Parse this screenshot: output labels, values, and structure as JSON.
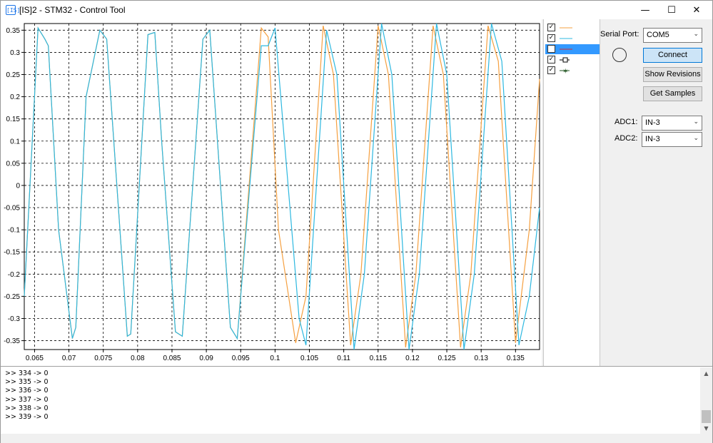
{
  "window": {
    "title": "[IS]2 - STM32 - Control Tool",
    "app_icon": "[IS]",
    "minimize_glyph": "—",
    "maximize_glyph": "☐",
    "close_glyph": "✕"
  },
  "legend": {
    "items": [
      {
        "checked": true,
        "color": "#f5a040",
        "marker": "line",
        "selected": false
      },
      {
        "checked": true,
        "color": "#2db8e0",
        "marker": "line",
        "selected": false
      },
      {
        "checked": false,
        "color": "#cc3333",
        "marker": "line",
        "selected": true
      },
      {
        "checked": true,
        "color": "#000000",
        "marker": "square",
        "selected": false
      },
      {
        "checked": true,
        "color": "#225522",
        "marker": "star",
        "selected": false
      }
    ],
    "check_glyph": "✓"
  },
  "controls": {
    "serial_port_label": "Serial Port:",
    "serial_port_value": "COM5",
    "connect_label": "Connect",
    "show_revisions_label": "Show Revisions",
    "get_samples_label": "Get Samples",
    "adc1_label": "ADC1:",
    "adc1_value": "IN-3",
    "adc2_label": "ADC2:",
    "adc2_value": "IN-3",
    "combo_arrow": "⌄"
  },
  "log": {
    "lines": [
      ">> 334 -> 0",
      ">> 335 -> 0",
      ">> 336 -> 0",
      ">> 337 -> 0",
      ">> 338 -> 0",
      ">> 339 -> 0"
    ],
    "scroll_up": "▲",
    "scroll_down": "▼"
  },
  "chart_data": {
    "type": "line",
    "xlim": [
      0.0635,
      0.1385
    ],
    "ylim": [
      -0.37,
      0.365
    ],
    "x_ticks": [
      0.065,
      0.07,
      0.075,
      0.08,
      0.085,
      0.09,
      0.095,
      0.1,
      0.105,
      0.11,
      0.115,
      0.12,
      0.125,
      0.13,
      0.135
    ],
    "x_tick_labels": [
      "0.065",
      "0.07",
      "0.075",
      "0.08",
      "0.085",
      "0.09",
      "0.095",
      "0.1",
      "0.105",
      "0.11",
      "0.115",
      "0.12",
      "0.125",
      "0.13",
      "0.135"
    ],
    "y_ticks": [
      -0.35,
      -0.3,
      -0.25,
      -0.2,
      -0.15,
      -0.1,
      -0.05,
      0,
      0.05,
      0.1,
      0.15,
      0.2,
      0.25,
      0.3,
      0.35
    ],
    "y_tick_labels": [
      "-0.35",
      "-0.3",
      "-0.25",
      "-0.2",
      "-0.15",
      "-0.1",
      "-0.05",
      "0",
      "0.05",
      "0.1",
      "0.15",
      "0.2",
      "0.25",
      "0.3",
      "0.35"
    ],
    "grid": true,
    "series": [
      {
        "color": "#f5a040",
        "x": [
          0.0635,
          0.0655,
          0.0665,
          0.067,
          0.0685,
          0.0705,
          0.071,
          0.0725,
          0.0745,
          0.0755,
          0.0785,
          0.079,
          0.0815,
          0.0825,
          0.0835,
          0.0855,
          0.0865,
          0.0895,
          0.0905,
          0.0935,
          0.0945,
          0.098,
          0.099,
          0.1005,
          0.103,
          0.1045,
          0.107,
          0.1085,
          0.111,
          0.1125,
          0.115,
          0.1165,
          0.119,
          0.1205,
          0.123,
          0.1245,
          0.127,
          0.1285,
          0.131,
          0.1325,
          0.135,
          0.137,
          0.1385
        ],
        "y": [
          -0.25,
          0.355,
          0.33,
          0.315,
          -0.1,
          -0.345,
          -0.32,
          0.2,
          0.35,
          0.33,
          -0.34,
          -0.335,
          0.34,
          0.345,
          0.1,
          -0.33,
          -0.34,
          0.33,
          0.35,
          -0.32,
          -0.345,
          0.355,
          0.335,
          -0.1,
          -0.355,
          -0.25,
          0.36,
          0.25,
          -0.36,
          -0.2,
          0.36,
          0.25,
          -0.365,
          -0.2,
          0.36,
          0.25,
          -0.365,
          -0.2,
          0.36,
          0.28,
          -0.355,
          -0.1,
          0.24
        ]
      },
      {
        "color": "#2db8e0",
        "x": [
          0.0635,
          0.0655,
          0.0665,
          0.067,
          0.0685,
          0.0705,
          0.071,
          0.0725,
          0.0745,
          0.0755,
          0.0785,
          0.079,
          0.0815,
          0.0825,
          0.0835,
          0.0855,
          0.0865,
          0.0895,
          0.0905,
          0.0935,
          0.0945,
          0.098,
          0.099,
          0.1,
          0.1035,
          0.1045,
          0.1075,
          0.109,
          0.1115,
          0.113,
          0.1155,
          0.117,
          0.1195,
          0.121,
          0.1235,
          0.125,
          0.1275,
          0.129,
          0.1315,
          0.133,
          0.1355,
          0.137,
          0.1385
        ],
        "y": [
          -0.25,
          0.355,
          0.33,
          0.315,
          -0.1,
          -0.345,
          -0.32,
          0.2,
          0.35,
          0.33,
          -0.34,
          -0.335,
          0.34,
          0.345,
          0.1,
          -0.33,
          -0.34,
          0.33,
          0.35,
          -0.32,
          -0.345,
          0.315,
          0.315,
          0.355,
          -0.3,
          -0.36,
          0.35,
          0.25,
          -0.37,
          -0.2,
          0.365,
          0.25,
          -0.37,
          -0.2,
          0.365,
          0.25,
          -0.37,
          -0.2,
          0.365,
          0.28,
          -0.36,
          -0.25,
          -0.05
        ]
      }
    ]
  }
}
